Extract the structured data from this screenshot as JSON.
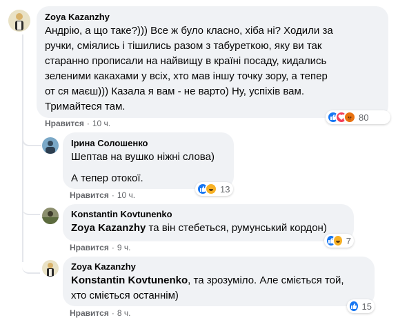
{
  "comments": [
    {
      "author": "Zoya Kazanzhy",
      "text_lines": [
        "Андрію, а що таке?))) Все ж було класно, хіба ні? Ходили за",
        "ручки, сміялись і тішились разом з табуреткою, яку ви так",
        "старанно прописали на найвищу в країні посаду, кидались",
        "зеленими какахами у всіх, хто мав іншу точку зору, а тепер",
        "от ся маєш))) Казала я вам - не варто) Ну, успіхів вам.",
        "Тримайтеся там."
      ],
      "like_label": "Нравится",
      "time": "10 ч.",
      "reaction_count": "80"
    },
    {
      "author": "Ірина Солошенко",
      "line1": "Шептав на вушко ніжні слова)",
      "line2": "А тепер отокої.",
      "like_label": "Нравится",
      "time": "10 ч.",
      "reaction_count": "13"
    },
    {
      "author": "Konstantin Kovtunenko",
      "mention": "Zoya Kazanzhy",
      "text": " та він стебеться, румунський кордон)",
      "like_label": "Нравится",
      "time": "9 ч.",
      "reaction_count": "7"
    },
    {
      "author": "Zoya Kazanzhy",
      "mention": "Konstantin Kovtunenko",
      "text": ", та зрозуміло. Але сміється той,",
      "line2": "хто сміється останнім)",
      "like_label": "Нравится",
      "time": "8 ч.",
      "reaction_count": "15"
    }
  ],
  "separator": "·",
  "colors": {
    "bubble": "#f0f2f5",
    "like_blue": "#1877f2",
    "love_red": "#f33e58",
    "haha_yellow": "#f7b125",
    "angry_orange": "#e9710f",
    "meta_gray": "#65676b"
  },
  "icons": [
    "like-reaction-icon",
    "love-reaction-icon",
    "angry-reaction-icon",
    "haha-reaction-icon"
  ]
}
